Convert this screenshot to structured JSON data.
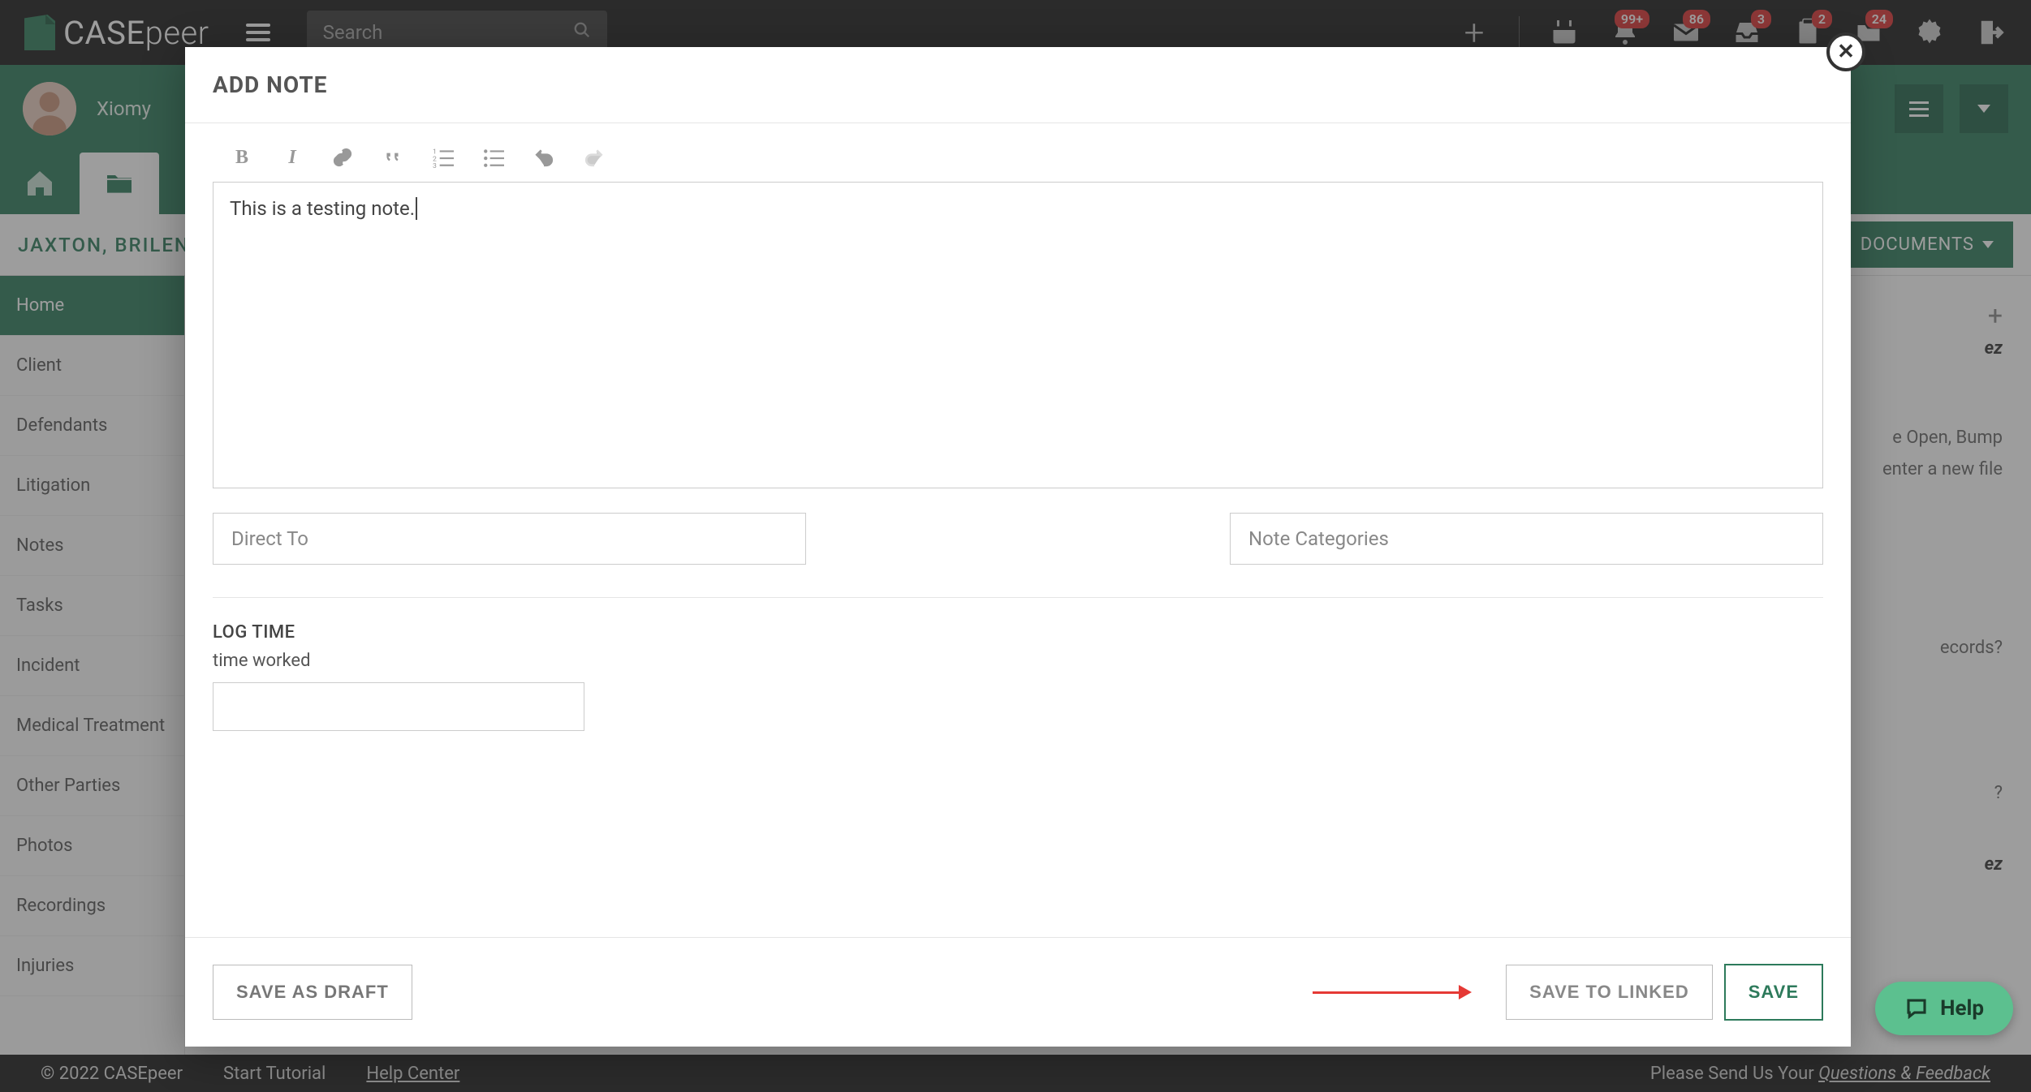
{
  "brand": {
    "prefix": "CASE",
    "suffix": "peer"
  },
  "search": {
    "placeholder": "Search"
  },
  "topbar_badges": {
    "bell": "99+",
    "mail": "86",
    "inbox": "3",
    "doc": "2",
    "folder": "24"
  },
  "user": {
    "name": "Xiomy"
  },
  "case": {
    "title": "JAXTON, BRILENE"
  },
  "documents_btn": "DOCUMENTS",
  "sidebar": {
    "items": [
      "Home",
      "Client",
      "Defendants",
      "Litigation",
      "Notes",
      "Tasks",
      "Incident",
      "Medical Treatment",
      "Other Parties",
      "Photos",
      "Recordings",
      "Injuries"
    ]
  },
  "bg_snippets": {
    "name_suffix": "ez",
    "line1": "e Open, Bump",
    "line2": "enter a new file",
    "line3": "ecords?",
    "line4": "?",
    "line5": "ez"
  },
  "modal": {
    "title": "ADD NOTE",
    "editor_content": "This is a testing note.",
    "direct_to_ph": "Direct To",
    "note_categories_ph": "Note Categories",
    "log_time_head": "LOG TIME",
    "log_time_sub": "time worked",
    "save_draft": "SAVE AS DRAFT",
    "save_linked": "SAVE TO LINKED",
    "save": "SAVE"
  },
  "footer": {
    "copyright": "© 2022 CASEpeer",
    "start_tutorial": "Start Tutorial",
    "help_center": "Help Center",
    "feedback_pre": "Please Send Us Your ",
    "feedback_link": "Questions & Feedback"
  },
  "help_fab": "Help"
}
